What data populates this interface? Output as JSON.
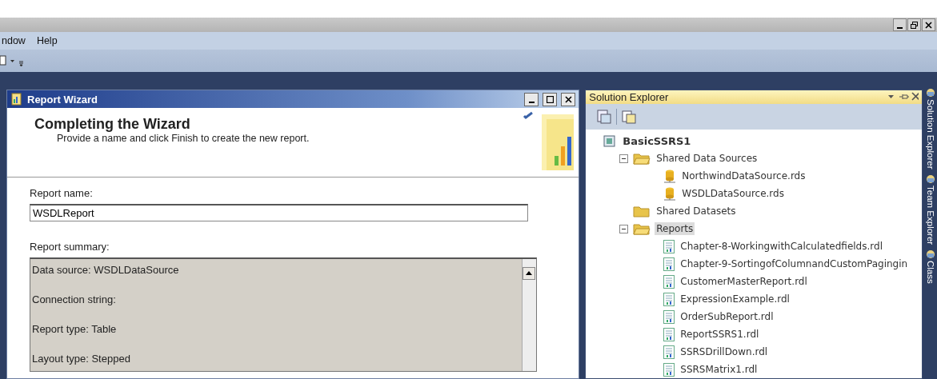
{
  "menu": [
    {
      "label": "ndow"
    },
    {
      "label": "Help"
    }
  ],
  "wizard": {
    "title": "Report Wizard",
    "heading": "Completing the Wizard",
    "subtitle": "Provide a name and click Finish to create the new report.",
    "name_label": "Report name:",
    "name_value": "WSDLReport",
    "summary_label": "Report summary:",
    "summary": [
      "Data source: WSDLDataSource",
      "Connection string:",
      "Report type: Table",
      "Layout type: Stepped"
    ]
  },
  "solution_explorer": {
    "title": "Solution Explorer",
    "tree": [
      {
        "label": "BasicSSRS1",
        "kind": "project",
        "selected": false,
        "children": [
          {
            "label": "Shared Data Sources",
            "kind": "folder",
            "expanded": true,
            "selected": false,
            "children": [
              {
                "label": "NorthwindDataSource.rds",
                "kind": "datasource",
                "selected": false
              },
              {
                "label": "WSDLDataSource.rds",
                "kind": "datasource",
                "selected": false
              }
            ]
          },
          {
            "label": "Shared Datasets",
            "kind": "folder",
            "expanded": false,
            "selected": false
          },
          {
            "label": "Reports",
            "kind": "folder",
            "expanded": true,
            "selected": true,
            "children": [
              {
                "label": "Chapter-8-WorkingwithCalculatedfields.rdl",
                "kind": "report",
                "selected": false
              },
              {
                "label": "Chapter-9-SortingofColumnandCustomPagingin",
                "kind": "report",
                "selected": false
              },
              {
                "label": "CustomerMasterReport.rdl",
                "kind": "report",
                "selected": false
              },
              {
                "label": "ExpressionExample.rdl",
                "kind": "report",
                "selected": false
              },
              {
                "label": "OrderSubReport.rdl",
                "kind": "report",
                "selected": false
              },
              {
                "label": "ReportSSRS1.rdl",
                "kind": "report",
                "selected": false
              },
              {
                "label": "SSRSDrillDown.rdl",
                "kind": "report",
                "selected": false
              },
              {
                "label": "SSRSMatrix1.rdl",
                "kind": "report",
                "selected": false
              }
            ]
          }
        ]
      }
    ]
  },
  "side_tabs": [
    {
      "label": "Solution Explorer"
    },
    {
      "label": "Team Explorer"
    },
    {
      "label": "Class"
    }
  ]
}
